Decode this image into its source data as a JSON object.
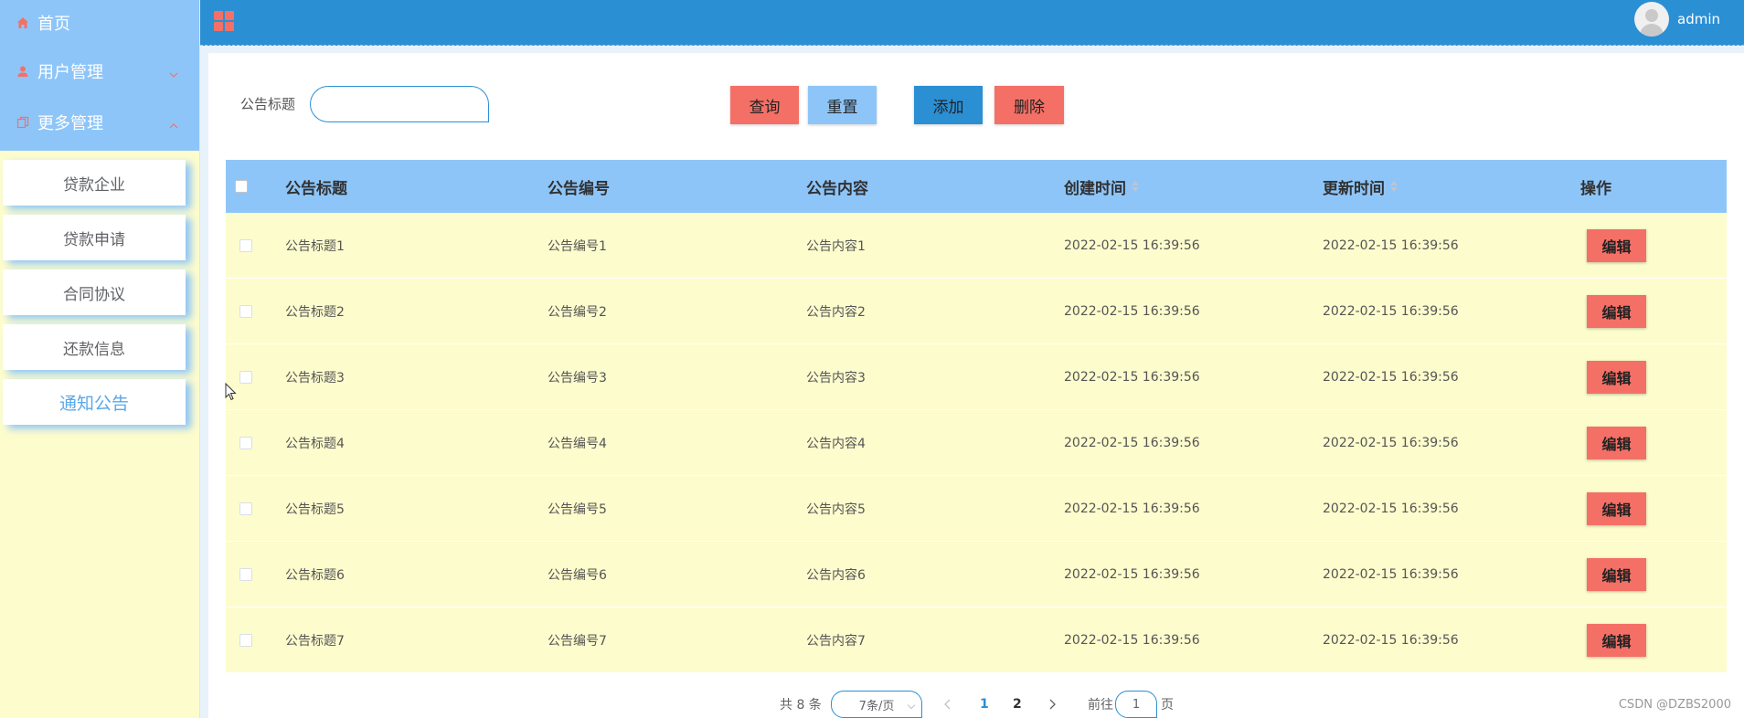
{
  "sidebar": {
    "home": "首页",
    "user_mgmt": "用户管理",
    "more_mgmt": "更多管理",
    "submenu": [
      "贷款企业",
      "贷款申请",
      "合同协议",
      "还款信息",
      "通知公告"
    ]
  },
  "header": {
    "username": "admin"
  },
  "search": {
    "label": "公告标题",
    "placeholder": ""
  },
  "buttons": {
    "query": "查询",
    "reset": "重置",
    "add": "添加",
    "delete": "删除"
  },
  "table": {
    "columns": [
      "公告标题",
      "公告编号",
      "公告内容",
      "创建时间",
      "更新时间",
      "操作"
    ],
    "edit_label": "编辑",
    "rows": [
      {
        "title": "公告标题1",
        "code": "公告编号1",
        "content": "公告内容1",
        "created": "2022-02-15 16:39:56",
        "updated": "2022-02-15 16:39:56"
      },
      {
        "title": "公告标题2",
        "code": "公告编号2",
        "content": "公告内容2",
        "created": "2022-02-15 16:39:56",
        "updated": "2022-02-15 16:39:56"
      },
      {
        "title": "公告标题3",
        "code": "公告编号3",
        "content": "公告内容3",
        "created": "2022-02-15 16:39:56",
        "updated": "2022-02-15 16:39:56"
      },
      {
        "title": "公告标题4",
        "code": "公告编号4",
        "content": "公告内容4",
        "created": "2022-02-15 16:39:56",
        "updated": "2022-02-15 16:39:56"
      },
      {
        "title": "公告标题5",
        "code": "公告编号5",
        "content": "公告内容5",
        "created": "2022-02-15 16:39:56",
        "updated": "2022-02-15 16:39:56"
      },
      {
        "title": "公告标题6",
        "code": "公告编号6",
        "content": "公告内容6",
        "created": "2022-02-15 16:39:56",
        "updated": "2022-02-15 16:39:56"
      },
      {
        "title": "公告标题7",
        "code": "公告编号7",
        "content": "公告内容7",
        "created": "2022-02-15 16:39:56",
        "updated": "2022-02-15 16:39:56"
      }
    ]
  },
  "pagination": {
    "total": "共 8 条",
    "page_size": "7条/页",
    "pages": [
      "1",
      "2"
    ],
    "current_page": "1",
    "goto_prefix": "前往",
    "goto_value": "1",
    "goto_suffix": "页"
  },
  "watermark": "CSDN @DZBS2000",
  "colors": {
    "sidebar_top": "#8ec5f8",
    "sidebar_bg": "#fdfccd",
    "header": "#2b8fd4",
    "accent_red": "#f47066",
    "accent_blue": "#2b8fd4",
    "light_blue": "#8ec5f8",
    "row_bg": "#fdfccd"
  },
  "icons": {
    "home": "home-icon",
    "user": "user-icon",
    "more": "copy-icon",
    "menu_toggle": "grid-icon",
    "avatar": "avatar-icon"
  }
}
